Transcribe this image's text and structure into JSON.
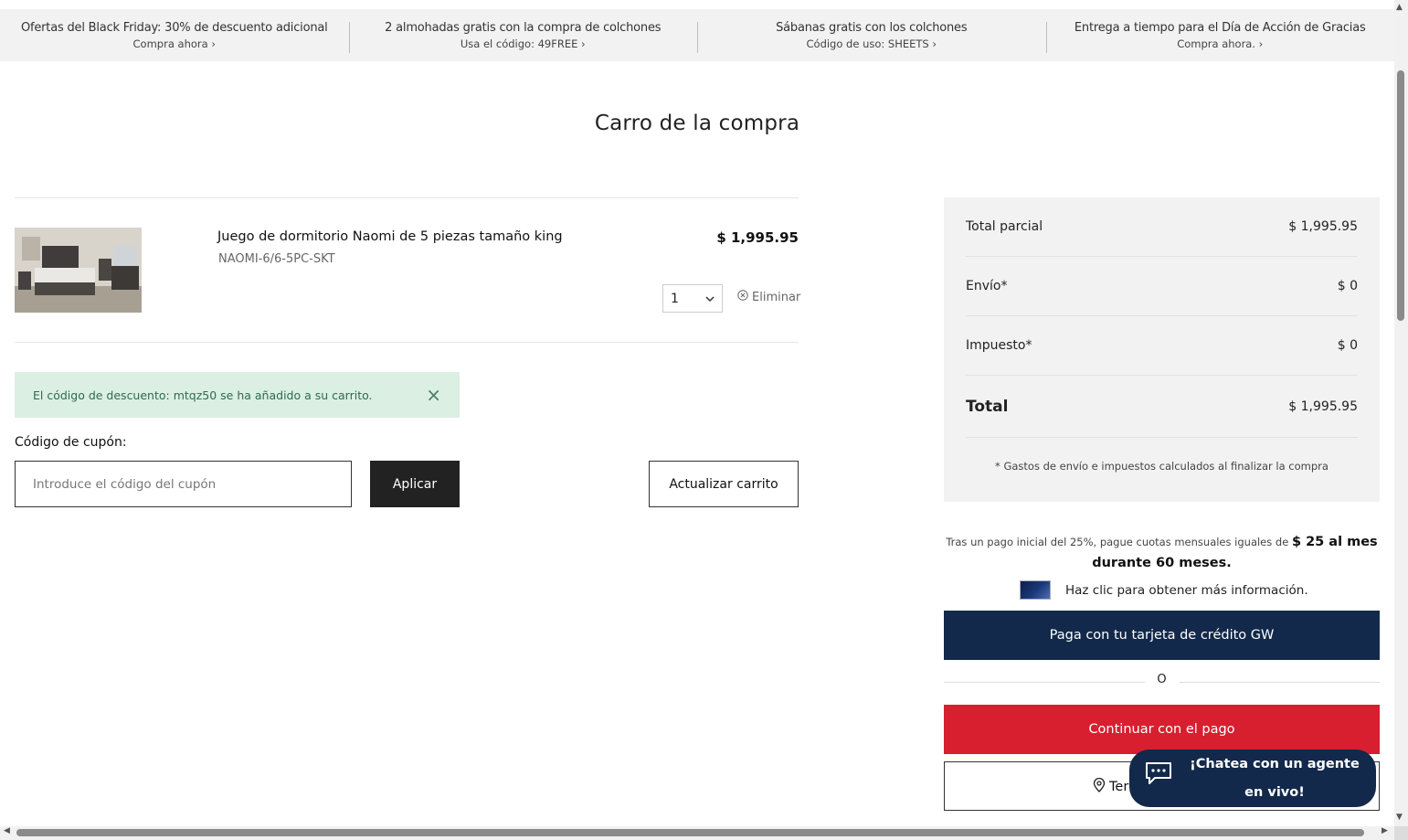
{
  "promo_bar": [
    {
      "title": "Ofertas del Black Friday: 30% de descuento adicional",
      "link": "Compra ahora"
    },
    {
      "title": "2 almohadas gratis con la compra de colchones",
      "link": "Usa el código: 49FREE"
    },
    {
      "title": "Sábanas gratis con los colchones",
      "link": "Código de uso: SHEETS"
    },
    {
      "title": "Entrega a tiempo para el Día de Acción de Gracias",
      "link": "Compra ahora."
    }
  ],
  "page_title": "Carro de la compra",
  "cart": {
    "item": {
      "name": "Juego de dormitorio Naomi de 5 piezas tamaño king",
      "sku": "NAOMI-6/6-5PC-SKT",
      "price": "$ 1,995.95",
      "quantity": "1",
      "remove_label": "Eliminar"
    },
    "alert": "El código de descuento: mtqz50 se ha añadido a su carrito.",
    "coupon_label": "Código de cupón:",
    "coupon_placeholder": "Introduce el código del cupón",
    "apply_label": "Aplicar",
    "update_label": "Actualizar carrito"
  },
  "summary": {
    "rows": [
      {
        "label": "Total parcial",
        "value": "$ 1,995.95"
      },
      {
        "label": "Envío*",
        "value": "$ 0"
      },
      {
        "label": "Impuesto*",
        "value": "$ 0"
      }
    ],
    "total_label": "Total",
    "total_value": "$ 1,995.95",
    "note": "* Gastos de envío e impuestos calculados al finalizar la compra"
  },
  "finance": {
    "text": "Tras un pago inicial del 25%, pague cuotas mensuales iguales de",
    "amount_line_1": "$ 25 al mes",
    "amount_line_2": "durante 60 meses.",
    "info": "Haz clic para obtener más información."
  },
  "buttons": {
    "gw_card": "Paga con tu tarjeta de crédito GW",
    "or": "O",
    "checkout": "Continuar con el pago",
    "store_partial": "Ter"
  },
  "chat": {
    "label": "¡Chatea con un agente en vivo!"
  },
  "colors": {
    "navy": "#13294b",
    "red": "#d71f30",
    "alert_bg": "#dbefe3",
    "summary_bg": "#f2f2f2"
  }
}
